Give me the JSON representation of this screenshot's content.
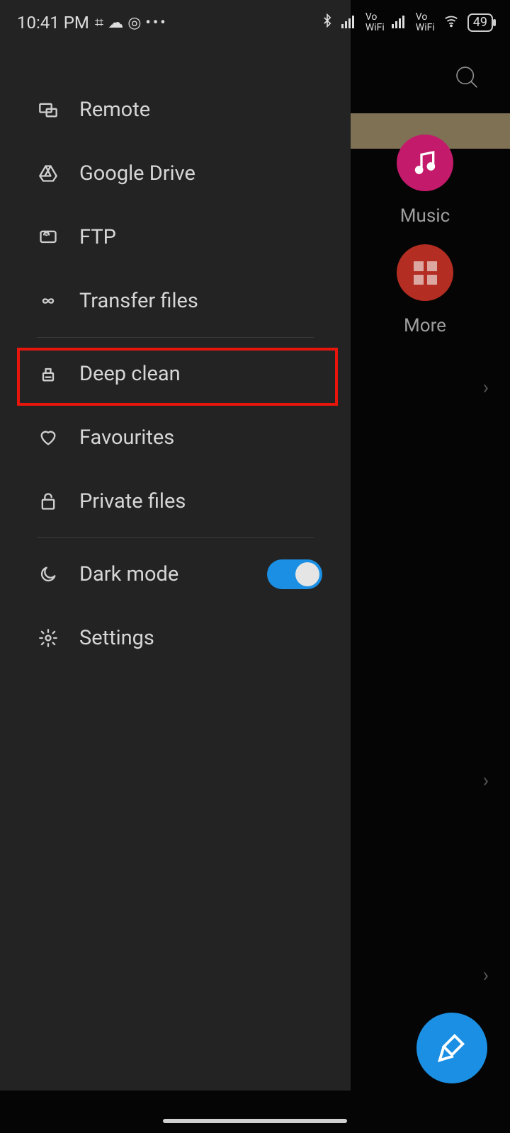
{
  "status": {
    "time": "10:41 PM",
    "battery": "49",
    "vo_label": "Vo",
    "wifi_label": "WiFi"
  },
  "back": {
    "music_label": "Music",
    "more_label": "More"
  },
  "drawer": {
    "items": [
      {
        "id": "remote",
        "label": "Remote",
        "icon": "remote-icon"
      },
      {
        "id": "google-drive",
        "label": "Google Drive",
        "icon": "gdrive-icon"
      },
      {
        "id": "ftp",
        "label": "FTP",
        "icon": "ftp-icon"
      },
      {
        "id": "transfer",
        "label": "Transfer files",
        "icon": "infinity-icon"
      },
      {
        "id": "deep-clean",
        "label": "Deep clean",
        "icon": "broom-icon"
      },
      {
        "id": "favourites",
        "label": "Favourites",
        "icon": "heart-icon"
      },
      {
        "id": "private",
        "label": "Private files",
        "icon": "lock-icon"
      },
      {
        "id": "dark-mode",
        "label": "Dark mode",
        "icon": "moon-icon",
        "toggle": true
      },
      {
        "id": "settings",
        "label": "Settings",
        "icon": "gear-icon"
      }
    ]
  },
  "highlight_item_index": 4,
  "colors": {
    "accent": "#1a8fe3",
    "drawer_bg": "#232323",
    "highlight": "#e6160c"
  }
}
